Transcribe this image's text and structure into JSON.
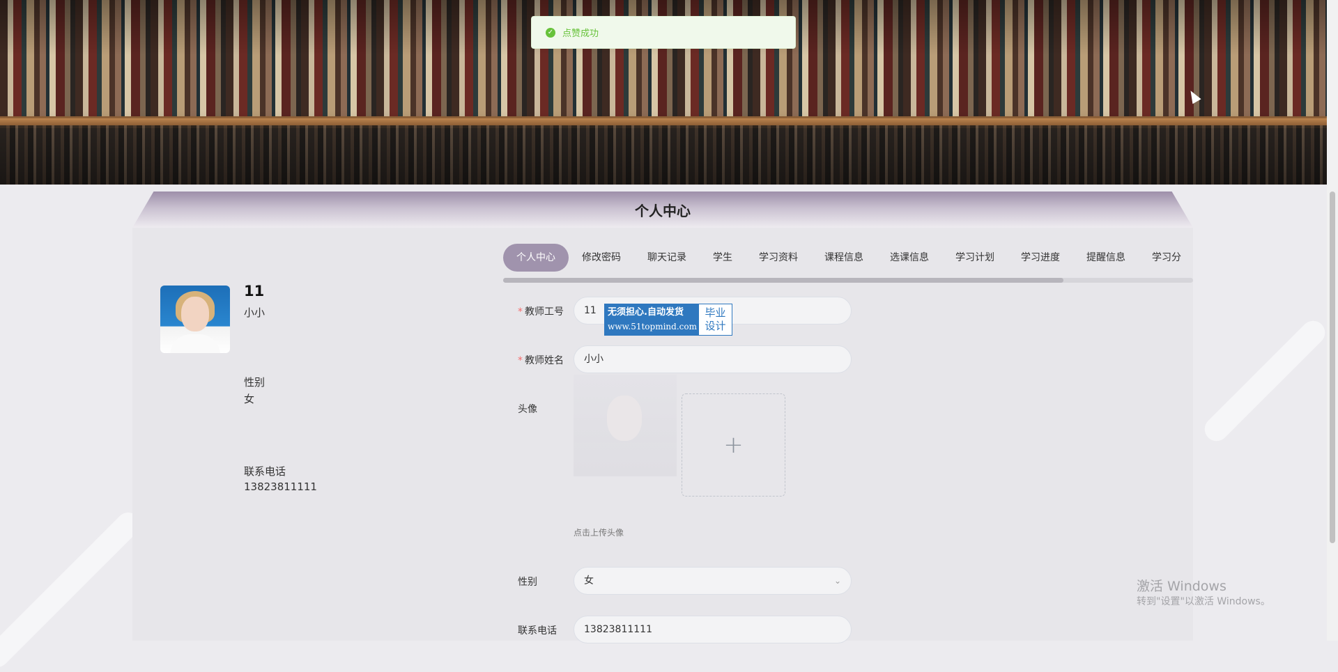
{
  "toast": {
    "message": "点赞成功"
  },
  "header": {
    "title": "个人中心"
  },
  "profile": {
    "number": "11",
    "name": "小小",
    "gender_label": "性别",
    "gender_value": "女",
    "phone_label": "联系电话",
    "phone_value": "13823811111"
  },
  "tabs": [
    "个人中心",
    "修改密码",
    "聊天记录",
    "学生",
    "学习资料",
    "课程信息",
    "选课信息",
    "学习计划",
    "学习进度",
    "提醒信息",
    "学习分"
  ],
  "form": {
    "teacher_id_label": "教师工号",
    "teacher_id_value": "11",
    "teacher_name_label": "教师姓名",
    "teacher_name_value": "小小",
    "avatar_label": "头像",
    "avatar_hint": "点击上传头像",
    "gender_label": "性别",
    "gender_value": "女",
    "phone_label": "联系电话",
    "phone_value": "13823811111"
  },
  "watermark_ad": {
    "line1": "无须担心.自动发货",
    "line2": "www.51topmind.com",
    "tag1": "毕业",
    "tag2": "设计"
  },
  "windows_activation": {
    "line1": "激活 Windows",
    "line2": "转到\"设置\"以激活 Windows。"
  },
  "icons": {
    "toast": "success-check-icon",
    "upload": "plus-icon",
    "select": "chevron-down-icon"
  },
  "colors": {
    "success": "#67c23a",
    "active_tab": "#a093ad",
    "required": "#f56c6c"
  }
}
